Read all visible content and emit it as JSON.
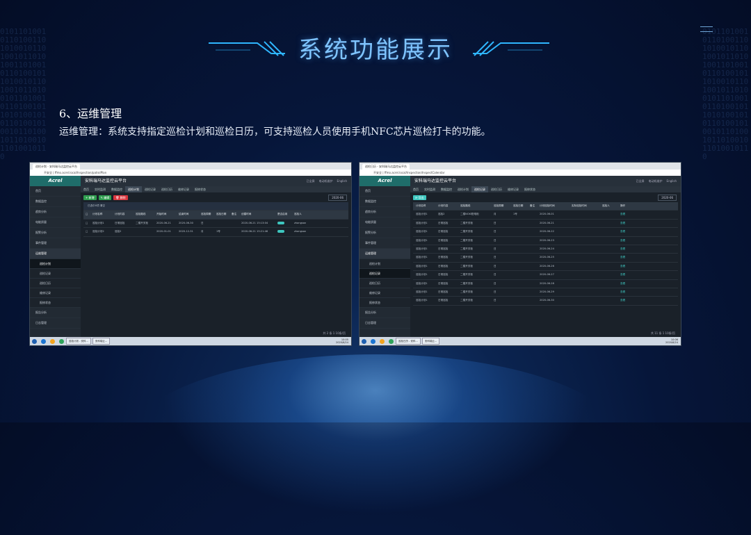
{
  "slide": {
    "title": "系统功能展示",
    "section_heading": "6、运维管理",
    "description": "运维管理：系统支持指定巡检计划和巡检日历，可支持巡检人员使用手机NFC芯片巡检打卡的功能。",
    "binary_text": "0101101001011010011010100101101001011010100110100101101001011010010110100101101001011010010110100101101010010101101001010010110100101101001011010010110"
  },
  "screenshots": [
    {
      "browser_tab": "巡检计划 - 安科瑞马达监控云平台",
      "address": "不安全 | ffmo.acrel.local/Inspection/patrolPlan",
      "logo": "Acrel",
      "app_title": "安科瑞马达监控云平台",
      "top_right": [
        "已全屏",
        "电动机维护",
        "English"
      ],
      "tabs": [
        "首页",
        "实时监测",
        "数据监控",
        "巡检计划",
        "巡检记录",
        "巡检日历",
        "维修记录",
        "报修状态"
      ],
      "active_tab": "巡检计划",
      "sidebar": [
        "首页",
        "数据监控",
        "趋势分析",
        "电能质量",
        "报警分析",
        "事件管理",
        "运维管理"
      ],
      "sidebar_sub": [
        "巡检计划",
        "巡检记录",
        "巡检日历",
        "维修记录",
        "报修状态"
      ],
      "sidebar_bottom": [
        "报告分析",
        "日志管理"
      ],
      "selected_sub": "巡检计划",
      "buttons": [
        "+ 新增",
        "✎ 编辑",
        "🗑 删除"
      ],
      "date": "2020-06",
      "filter_label": "已选中0项 清空",
      "columns": [
        "计划名称",
        "计划内容",
        "巡检路线",
        "开始时间",
        "结束时间",
        "巡检周期",
        "巡检日期",
        "备注",
        "创建时间",
        "是否启用",
        "巡检人"
      ],
      "rows": [
        [
          "巡检计划1",
          "日常巡检",
          "二楼开关柜",
          "2020-06-21",
          "2020-06-30",
          "日",
          "",
          "",
          "2020-06-21 15:13:04",
          "",
          "zhangsan"
        ],
        [
          "巡检计划2",
          "巡检2",
          "",
          "2020-01-01",
          "2020-12-31",
          "月",
          "1号",
          "",
          "2020-06-21 15:21:46",
          "",
          "zhangsan"
        ]
      ],
      "pager": "共 2 条  1  10条/页",
      "taskbar": [
        "巡检计划 - 安科...",
        "安科瑞云..."
      ],
      "clock": [
        "10:05",
        "2020/6/24"
      ]
    },
    {
      "browser_tab": "巡检日历 - 安科瑞马达监控云平台",
      "address": "不安全 | ffmo.acrel.local/Inspection/InspectCalendar",
      "logo": "Acrel",
      "app_title": "安科瑞马达监控云平台",
      "top_right": [
        "已全屏",
        "电动机维护",
        "English"
      ],
      "tabs": [
        "首页",
        "实时监测",
        "数据监控",
        "巡检计划",
        "巡检记录",
        "巡检日历",
        "维修记录",
        "报修状态"
      ],
      "active_tab": "巡检记录",
      "sidebar": [
        "首页",
        "数据监控",
        "趋势分析",
        "电能质量",
        "报警分析",
        "事件管理",
        "运维管理"
      ],
      "sidebar_sub": [
        "巡检计划",
        "巡检记录",
        "巡检日历",
        "维修记录",
        "报修状态"
      ],
      "sidebar_bottom": [
        "报告分析",
        "日志管理"
      ],
      "selected_sub": "巡检记录",
      "buttons": [
        "⟳ 导出"
      ],
      "date": "2020-06",
      "filter_label": "",
      "columns": [
        "计划名称",
        "计划内容",
        "巡检路线",
        "巡检周期",
        "巡检日期",
        "备注",
        "计划巡检时间",
        "实际巡检时间",
        "巡检人",
        "操作"
      ],
      "rows": [
        [
          "巡检计划1",
          "巡检2",
          "二楼NOXI配电柜",
          "月",
          "1号",
          "",
          "2020-06-01",
          "",
          "",
          "查看"
        ],
        [
          "巡检计划1",
          "日常巡检",
          "二楼开关柜",
          "日",
          "",
          "",
          "2020-06-21",
          "",
          "",
          "查看"
        ],
        [
          "巡检计划1",
          "日常巡检",
          "二楼开关柜",
          "日",
          "",
          "",
          "2020-06-22",
          "",
          "",
          "查看"
        ],
        [
          "巡检计划1",
          "日常巡检",
          "二楼开关柜",
          "日",
          "",
          "",
          "2020-06-23",
          "",
          "",
          "查看"
        ],
        [
          "巡检计划1",
          "日常巡检",
          "二楼开关柜",
          "日",
          "",
          "",
          "2020-06-24",
          "",
          "",
          "查看"
        ],
        [
          "巡检计划1",
          "日常巡检",
          "二楼开关柜",
          "日",
          "",
          "",
          "2020-06-25",
          "",
          "",
          "查看"
        ],
        [
          "巡检计划1",
          "日常巡检",
          "二楼开关柜",
          "日",
          "",
          "",
          "2020-06-26",
          "",
          "",
          "查看"
        ],
        [
          "巡检计划1",
          "日常巡检",
          "二楼开关柜",
          "日",
          "",
          "",
          "2020-06-27",
          "",
          "",
          "查看"
        ],
        [
          "巡检计划1",
          "日常巡检",
          "二楼开关柜",
          "日",
          "",
          "",
          "2020-06-28",
          "",
          "",
          "查看"
        ],
        [
          "巡检计划1",
          "日常巡检",
          "二楼开关柜",
          "日",
          "",
          "",
          "2020-06-29",
          "",
          "",
          "查看"
        ],
        [
          "巡检计划1",
          "日常巡检",
          "二楼开关柜",
          "日",
          "",
          "",
          "2020-06-30",
          "",
          "",
          "查看"
        ]
      ],
      "pager": "共 11 条  1  10条/页",
      "taskbar": [
        "巡检日历 - 安科...",
        "安科瑞云..."
      ],
      "clock": [
        "10:06",
        "2020/6/24"
      ]
    }
  ],
  "colors": {
    "accent": "#3ec7c0",
    "title": "#7fc4ff",
    "add_btn": "#2f9e4f",
    "edit_btn": "#2f9e4f",
    "del_btn": "#d9363e"
  }
}
